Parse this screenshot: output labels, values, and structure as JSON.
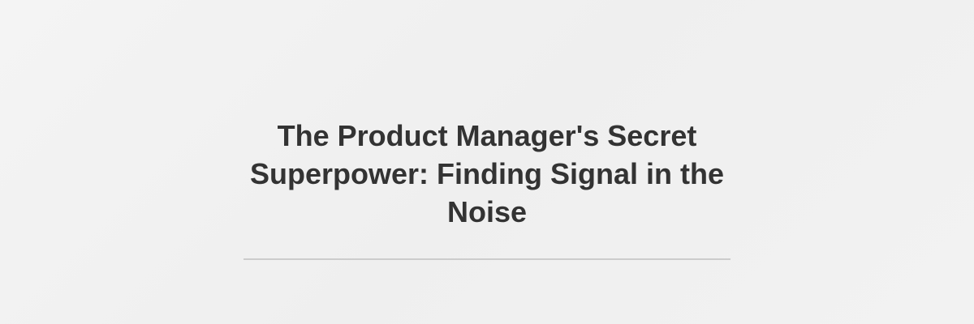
{
  "hero": {
    "title": "The Product Manager's Secret Superpower: Finding Signal in the Noise"
  },
  "colors": {
    "background": "#f2f2f2",
    "title_text": "#333333",
    "divider": "#cccccc"
  }
}
